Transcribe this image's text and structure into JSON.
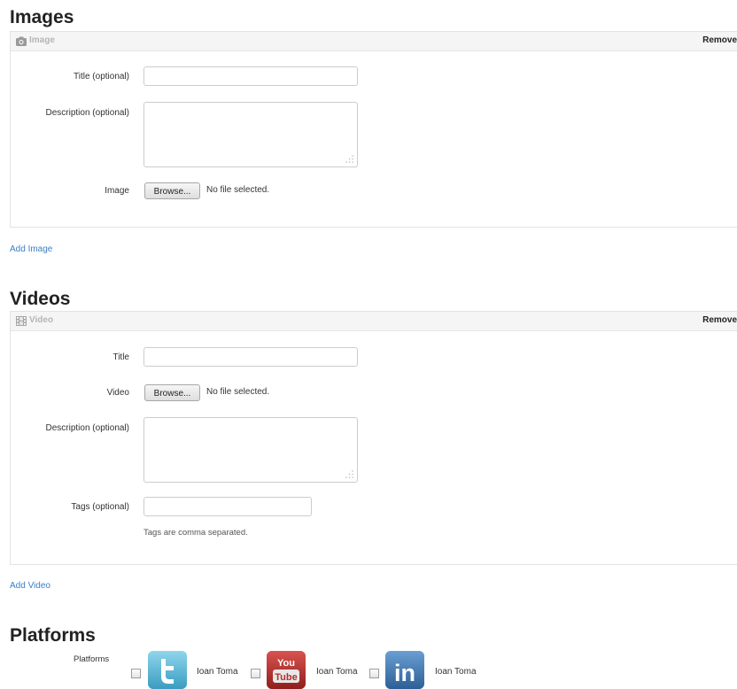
{
  "images_section": {
    "title": "Images",
    "panel": {
      "label": "Image",
      "remove_label": "Remove",
      "icon": "camera-icon"
    },
    "fields": {
      "title_label": "Title (optional)",
      "title_value": "",
      "description_label": "Description (optional)",
      "description_value": "",
      "image_label": "Image",
      "browse_label": "Browse...",
      "file_status": "No file selected."
    },
    "add_link": "Add Image"
  },
  "videos_section": {
    "title": "Videos",
    "panel": {
      "label": "Video",
      "remove_label": "Remove",
      "icon": "film-icon"
    },
    "fields": {
      "title_label": "Title",
      "title_value": "",
      "video_label": "Video",
      "browse_label": "Browse...",
      "file_status": "No file selected.",
      "description_label": "Description (optional)",
      "description_value": "",
      "tags_label": "Tags (optional)",
      "tags_value": "",
      "tags_help": "Tags are comma separated."
    },
    "add_link": "Add Video"
  },
  "platforms_section": {
    "title": "Platforms",
    "label": "Platforms",
    "items": [
      {
        "platform": "twitter",
        "icon": "twitter-icon",
        "account": "Ioan Toma",
        "checked": false,
        "color": "#5fb8d6"
      },
      {
        "platform": "youtube",
        "icon": "youtube-icon",
        "account": "Ioan Toma",
        "checked": false,
        "color": "#b0302c",
        "logo_text_top": "You",
        "logo_text_bottom": "Tube"
      },
      {
        "platform": "linkedin",
        "icon": "linkedin-icon",
        "account": "Ioan Toma",
        "checked": false,
        "color": "#3b73ad",
        "logo_text": "in"
      }
    ]
  },
  "colors": {
    "link": "#3a7fc4",
    "panel_header": "#f5f5f5",
    "border": "#cccccc"
  }
}
